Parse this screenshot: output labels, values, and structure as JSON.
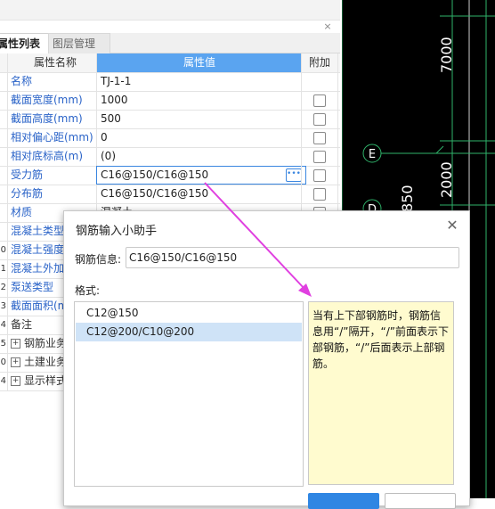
{
  "panel": {
    "tabs": [
      {
        "label": "属性列表"
      },
      {
        "label": "图层管理"
      }
    ],
    "close_glyph": "×",
    "header": {
      "name": "属性名称",
      "value": "属性值",
      "extra": "附加"
    },
    "rows": [
      {
        "idx": "",
        "name": "名称",
        "value": "TJ-1-1",
        "check": false
      },
      {
        "idx": "",
        "name": "截面宽度(mm)",
        "value": "1000",
        "check": true
      },
      {
        "idx": "",
        "name": "截面高度(mm)",
        "value": "500",
        "check": true
      },
      {
        "idx": "",
        "name": "相对偏心距(mm)",
        "value": "0",
        "check": true
      },
      {
        "idx": "",
        "name": "相对底标高(m)",
        "value": "(0)",
        "check": true
      },
      {
        "idx": "",
        "name": "受力筋",
        "value": "C16@150/C16@150",
        "check": true
      },
      {
        "idx": "",
        "name": "分布筋",
        "value": "C16@150/C16@150",
        "check": true
      },
      {
        "idx": "",
        "name": "材质",
        "value": "混凝土",
        "check": true
      },
      {
        "idx": "",
        "name": "混凝土类型",
        "value": "",
        "check": false
      },
      {
        "idx": "0",
        "name": "混凝土强度",
        "value": "",
        "check": false
      },
      {
        "idx": "1",
        "name": "混凝土外加",
        "value": "",
        "check": false
      },
      {
        "idx": "2",
        "name": "泵送类型",
        "value": "",
        "check": false
      },
      {
        "idx": "3",
        "name": "截面面积(m",
        "value": "",
        "check": false
      },
      {
        "idx": "4",
        "name": "备注",
        "value": "",
        "check": false
      },
      {
        "idx": "5",
        "name": "钢筋业务",
        "value": "",
        "check": false,
        "expander": "+"
      },
      {
        "idx": "0",
        "name": "土建业务",
        "value": "",
        "check": false,
        "expander": "+"
      },
      {
        "idx": "4",
        "name": "显示样式",
        "value": "",
        "check": false,
        "expander": "+"
      }
    ]
  },
  "cad": {
    "labels": [
      "7000",
      "2000",
      "850"
    ],
    "axis_marks": [
      "E",
      "D"
    ]
  },
  "dialog": {
    "title": "钢筋输入小助手",
    "close_glyph": "✕",
    "info_label": "钢筋信息:",
    "info_value": "C16@150/C16@150",
    "format_label": "格式:",
    "formats": [
      "C12@150",
      "C12@200/C10@200"
    ],
    "hint": "当有上下部钢筋时，钢筋信息用“/”隔开，“/”前面表示下部钢筋，“/”后面表示上部钢筋。"
  },
  "colors": {
    "accent": "#5aa4f0",
    "arrow": "#e040e0",
    "cad_grid": "#2fb36a",
    "hint_bg": "#fffbcf"
  }
}
